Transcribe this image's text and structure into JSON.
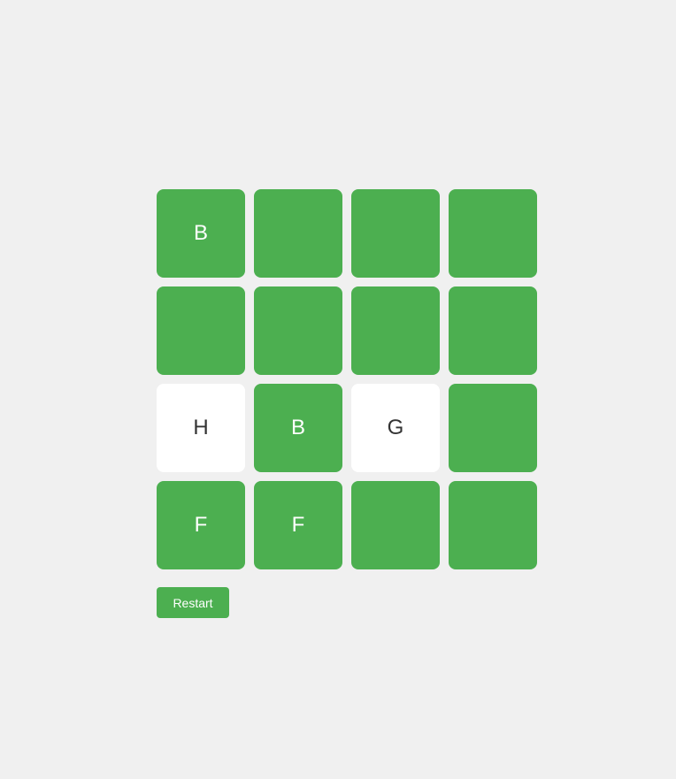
{
  "colors": {
    "background": "#f0f0f0",
    "tile_green": "#4caf50",
    "tile_white": "#ffffff",
    "text_on_white": "#333333",
    "text_on_green": "#ffffff"
  },
  "board": {
    "rows": 4,
    "cols": 4,
    "tiles": [
      {
        "letter": "B",
        "state": "green"
      },
      {
        "letter": "",
        "state": "green"
      },
      {
        "letter": "",
        "state": "green"
      },
      {
        "letter": "",
        "state": "green"
      },
      {
        "letter": "",
        "state": "green"
      },
      {
        "letter": "",
        "state": "green"
      },
      {
        "letter": "",
        "state": "green"
      },
      {
        "letter": "",
        "state": "green"
      },
      {
        "letter": "H",
        "state": "white"
      },
      {
        "letter": "B",
        "state": "green"
      },
      {
        "letter": "G",
        "state": "white"
      },
      {
        "letter": "",
        "state": "green"
      },
      {
        "letter": "F",
        "state": "green"
      },
      {
        "letter": "F",
        "state": "green"
      },
      {
        "letter": "",
        "state": "green"
      },
      {
        "letter": "",
        "state": "green"
      }
    ]
  },
  "controls": {
    "restart_label": "Restart"
  }
}
